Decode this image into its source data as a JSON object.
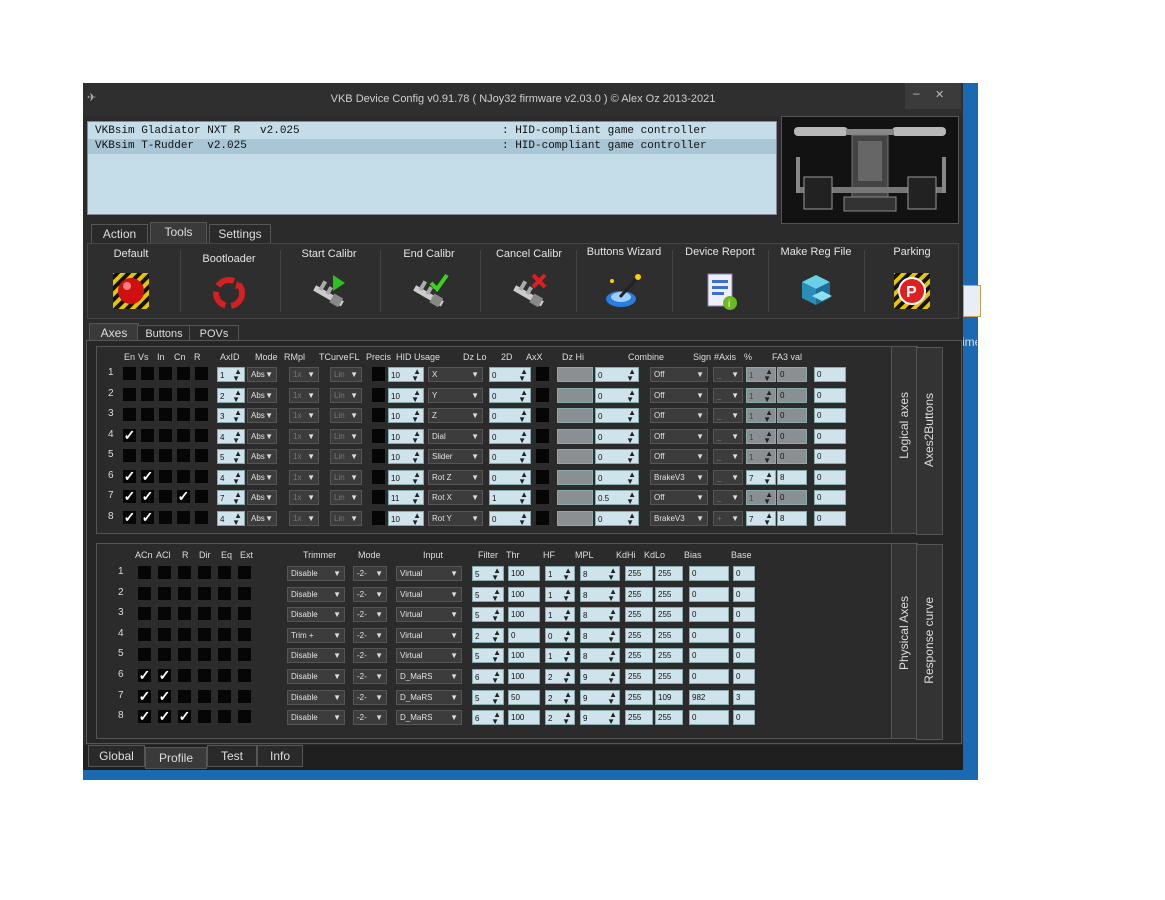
{
  "window": {
    "title": "VKB Device Config v0.91.78 ( NJoy32 firmware v2.03.0 ) © Alex Oz 2013-2021",
    "minimize": "–",
    "close": "✕"
  },
  "devices": [
    {
      "name": "VKBsim Gladiator NXT R   v2.025",
      "type": ": HID-compliant game controller"
    },
    {
      "name": "VKBsim T-Rudder  v2.025",
      "type": ": HID-compliant game controller"
    }
  ],
  "main_tabs": [
    "Action",
    "Tools",
    "Settings"
  ],
  "tools": [
    {
      "label": "Default",
      "icon": "red-ball-hazard-icon"
    },
    {
      "label": "Bootloader",
      "icon": "recycle-icon"
    },
    {
      "label": "Start Calibr",
      "icon": "caliper-play-icon"
    },
    {
      "label": "End Calibr",
      "icon": "caliper-check-icon"
    },
    {
      "label": "Cancel Calibr",
      "icon": "caliper-cancel-icon"
    },
    {
      "label": "Buttons Wizard",
      "icon": "wand-icon"
    },
    {
      "label": "Device Report",
      "icon": "report-icon"
    },
    {
      "label": "Make Reg File",
      "icon": "registry-cubes-icon"
    },
    {
      "label": "Parking",
      "icon": "parking-hazard-icon"
    }
  ],
  "sub_tabs": [
    "Axes",
    "Buttons",
    "POVs"
  ],
  "logical": {
    "headers": [
      "En",
      "Vs",
      "In",
      "Cn",
      "R",
      "AxID",
      "Mode",
      "RMpl",
      "TCurve",
      "FL",
      "Precis",
      "HID Usage",
      "Dz Lo",
      "2D",
      "AxX",
      "Dz Hi",
      "Combine",
      "Sign",
      "#Axis",
      "%",
      "FA3 val"
    ],
    "side_label_1": "Logical axes",
    "side_label_2": "Axes2Buttons",
    "rows": [
      {
        "n": "1",
        "en": "",
        "vs": "",
        "in": "",
        "cn": "",
        "r": "",
        "axid": "1",
        "mode": "Abs",
        "rmpl": "1x",
        "tcurve": "Lin",
        "precis": "10",
        "hid": "X",
        "dzlo": "0",
        "dzhi": "0",
        "combine": "Off",
        "sign": "_",
        "naxis": "1",
        "pct": "0",
        "fa3": "0"
      },
      {
        "n": "2",
        "en": "",
        "vs": "",
        "in": "",
        "cn": "",
        "r": "",
        "axid": "2",
        "mode": "Abs",
        "rmpl": "1x",
        "tcurve": "Lin",
        "precis": "10",
        "hid": "Y",
        "dzlo": "0",
        "dzhi": "0",
        "combine": "Off",
        "sign": "_",
        "naxis": "1",
        "pct": "0",
        "fa3": "0"
      },
      {
        "n": "3",
        "en": "",
        "vs": "",
        "in": "",
        "cn": "",
        "r": "",
        "axid": "3",
        "mode": "Abs",
        "rmpl": "1x",
        "tcurve": "Lin",
        "precis": "10",
        "hid": "Z",
        "dzlo": "0",
        "dzhi": "0",
        "combine": "Off",
        "sign": "_",
        "naxis": "1",
        "pct": "0",
        "fa3": "0"
      },
      {
        "n": "4",
        "en": "✓",
        "vs": "",
        "in": "",
        "cn": "",
        "r": "",
        "axid": "4",
        "mode": "Abs",
        "rmpl": "1x",
        "tcurve": "Lin",
        "precis": "10",
        "hid": "Dial",
        "dzlo": "0",
        "dzhi": "0",
        "combine": "Off",
        "sign": "_",
        "naxis": "1",
        "pct": "0",
        "fa3": "0"
      },
      {
        "n": "5",
        "en": "",
        "vs": "",
        "in": "",
        "cn": "",
        "r": "",
        "axid": "5",
        "mode": "Abs",
        "rmpl": "1x",
        "tcurve": "Lin",
        "precis": "10",
        "hid": "Slider",
        "dzlo": "0",
        "dzhi": "0",
        "combine": "Off",
        "sign": "_",
        "naxis": "1",
        "pct": "0",
        "fa3": "0"
      },
      {
        "n": "6",
        "en": "✓",
        "vs": "✓",
        "in": "",
        "cn": "",
        "r": "",
        "axid": "4",
        "mode": "Abs",
        "rmpl": "1x",
        "tcurve": "Lin",
        "precis": "10",
        "hid": "Rot Z",
        "dzlo": "0",
        "dzhi": "0",
        "combine": "BrakeV3",
        "sign": "_",
        "naxis": "7",
        "pct": "8",
        "fa3": "0"
      },
      {
        "n": "7",
        "en": "✓",
        "vs": "✓",
        "in": "",
        "cn": "✓",
        "r": "",
        "axid": "7",
        "mode": "Abs",
        "rmpl": "1x",
        "tcurve": "Lin",
        "precis": "11",
        "hid": "Rot X",
        "dzlo": "1",
        "dzhi": "0.5",
        "combine": "Off",
        "sign": "_",
        "naxis": "1",
        "pct": "0",
        "fa3": "0"
      },
      {
        "n": "8",
        "en": "✓",
        "vs": "✓",
        "in": "",
        "cn": "",
        "r": "",
        "axid": "4",
        "mode": "Abs",
        "rmpl": "1x",
        "tcurve": "Lin",
        "precis": "10",
        "hid": "Rot Y",
        "dzlo": "0",
        "dzhi": "0",
        "combine": "BrakeV3",
        "sign": "+",
        "naxis": "7",
        "pct": "8",
        "fa3": "0"
      }
    ]
  },
  "physical": {
    "headers": [
      "ACn",
      "ACl",
      "R",
      "Dir",
      "Eq",
      "Ext",
      "Trimmer",
      "Mode",
      "Input",
      "Filter",
      "Thr",
      "HF",
      "MPL",
      "KdHi",
      "KdLo",
      "Bias",
      "Base"
    ],
    "side_label_1": "Physical Axes",
    "side_label_2": "Response curve",
    "rows": [
      {
        "n": "1",
        "acn": "",
        "acl": "",
        "r": "",
        "trimmer": "Disable",
        "mode": "-2-",
        "input": "Virtual",
        "filter": "5",
        "thr": "100",
        "hf": "1",
        "mpl": "8",
        "kdhi": "255",
        "kdlo": "255",
        "bias": "0",
        "base": "0"
      },
      {
        "n": "2",
        "acn": "",
        "acl": "",
        "r": "",
        "trimmer": "Disable",
        "mode": "-2-",
        "input": "Virtual",
        "filter": "5",
        "thr": "100",
        "hf": "1",
        "mpl": "8",
        "kdhi": "255",
        "kdlo": "255",
        "bias": "0",
        "base": "0"
      },
      {
        "n": "3",
        "acn": "",
        "acl": "",
        "r": "",
        "trimmer": "Disable",
        "mode": "-2-",
        "input": "Virtual",
        "filter": "5",
        "thr": "100",
        "hf": "1",
        "mpl": "8",
        "kdhi": "255",
        "kdlo": "255",
        "bias": "0",
        "base": "0"
      },
      {
        "n": "4",
        "acn": "",
        "acl": "",
        "r": "",
        "trimmer": "Trim +",
        "mode": "-2-",
        "input": "Virtual",
        "filter": "2",
        "thr": "0",
        "hf": "0",
        "mpl": "8",
        "kdhi": "255",
        "kdlo": "255",
        "bias": "0",
        "base": "0"
      },
      {
        "n": "5",
        "acn": "",
        "acl": "",
        "r": "",
        "trimmer": "Disable",
        "mode": "-2-",
        "input": "Virtual",
        "filter": "5",
        "thr": "100",
        "hf": "1",
        "mpl": "8",
        "kdhi": "255",
        "kdlo": "255",
        "bias": "0",
        "base": "0"
      },
      {
        "n": "6",
        "acn": "✓",
        "acl": "✓",
        "r": "",
        "trimmer": "Disable",
        "mode": "-2-",
        "input": "D_MaRS",
        "filter": "6",
        "thr": "100",
        "hf": "2",
        "mpl": "9",
        "kdhi": "255",
        "kdlo": "255",
        "bias": "0",
        "base": "0"
      },
      {
        "n": "7",
        "acn": "✓",
        "acl": "✓",
        "r": "",
        "trimmer": "Disable",
        "mode": "-2-",
        "input": "D_MaRS",
        "filter": "5",
        "thr": "50",
        "hf": "2",
        "mpl": "9",
        "kdhi": "255",
        "kdlo": "109",
        "bias": "982",
        "base": "3"
      },
      {
        "n": "8",
        "acn": "✓",
        "acl": "✓",
        "r": "✓",
        "trimmer": "Disable",
        "mode": "-2-",
        "input": "D_MaRS",
        "filter": "6",
        "thr": "100",
        "hf": "2",
        "mpl": "9",
        "kdhi": "255",
        "kdlo": "255",
        "bias": "0",
        "base": "0"
      }
    ]
  },
  "bottom_tabs": [
    "Global",
    "Profile",
    "Test",
    "Info"
  ],
  "edge_text": "ime",
  "colors": {
    "window_bg": "#2b2b2b",
    "field_bg": "#cfe3ec",
    "list_bg": "#c4dde8",
    "desktop_blue": "#1b69b0"
  }
}
